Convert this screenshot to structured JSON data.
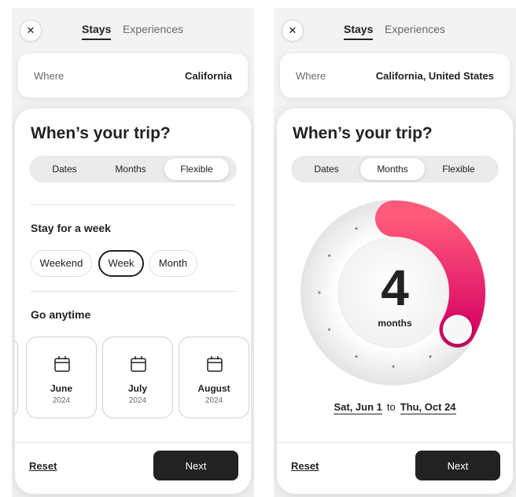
{
  "header": {
    "close_icon": "close-icon",
    "tabs": [
      {
        "label": "Stays",
        "active": true
      },
      {
        "label": "Experiences",
        "active": false
      }
    ]
  },
  "left": {
    "where": {
      "label": "Where",
      "value": "California"
    },
    "title": "When’s your trip?",
    "segments": [
      {
        "label": "Dates"
      },
      {
        "label": "Months"
      },
      {
        "label": "Flexible"
      }
    ],
    "selected_segment": "Flexible",
    "stay": {
      "title": "Stay for a week",
      "options": [
        "Weekend",
        "Week",
        "Month"
      ],
      "selected": "Week"
    },
    "go": {
      "title": "Go anytime",
      "months": [
        {
          "name": "June",
          "year": "2024"
        },
        {
          "name": "July",
          "year": "2024"
        },
        {
          "name": "August",
          "year": "2024"
        }
      ],
      "month_icon": "calendar-icon"
    },
    "footer": {
      "reset": "Reset",
      "next": "Next"
    }
  },
  "right": {
    "where": {
      "label": "Where",
      "value": "California, United States"
    },
    "title": "When’s your trip?",
    "segments": [
      {
        "label": "Dates"
      },
      {
        "label": "Months"
      },
      {
        "label": "Flexible"
      }
    ],
    "selected_segment": "Months",
    "dial": {
      "value": "4",
      "unit": "months",
      "fraction": 0.333
    },
    "range": {
      "start": "Sat, Jun 1",
      "sep": "to",
      "end": "Thu, Oct 24"
    },
    "footer": {
      "reset": "Reset",
      "next": "Next"
    }
  },
  "colors": {
    "accent": "#e61e4d",
    "accent_light": "#ff385c",
    "dark": "#222222"
  }
}
